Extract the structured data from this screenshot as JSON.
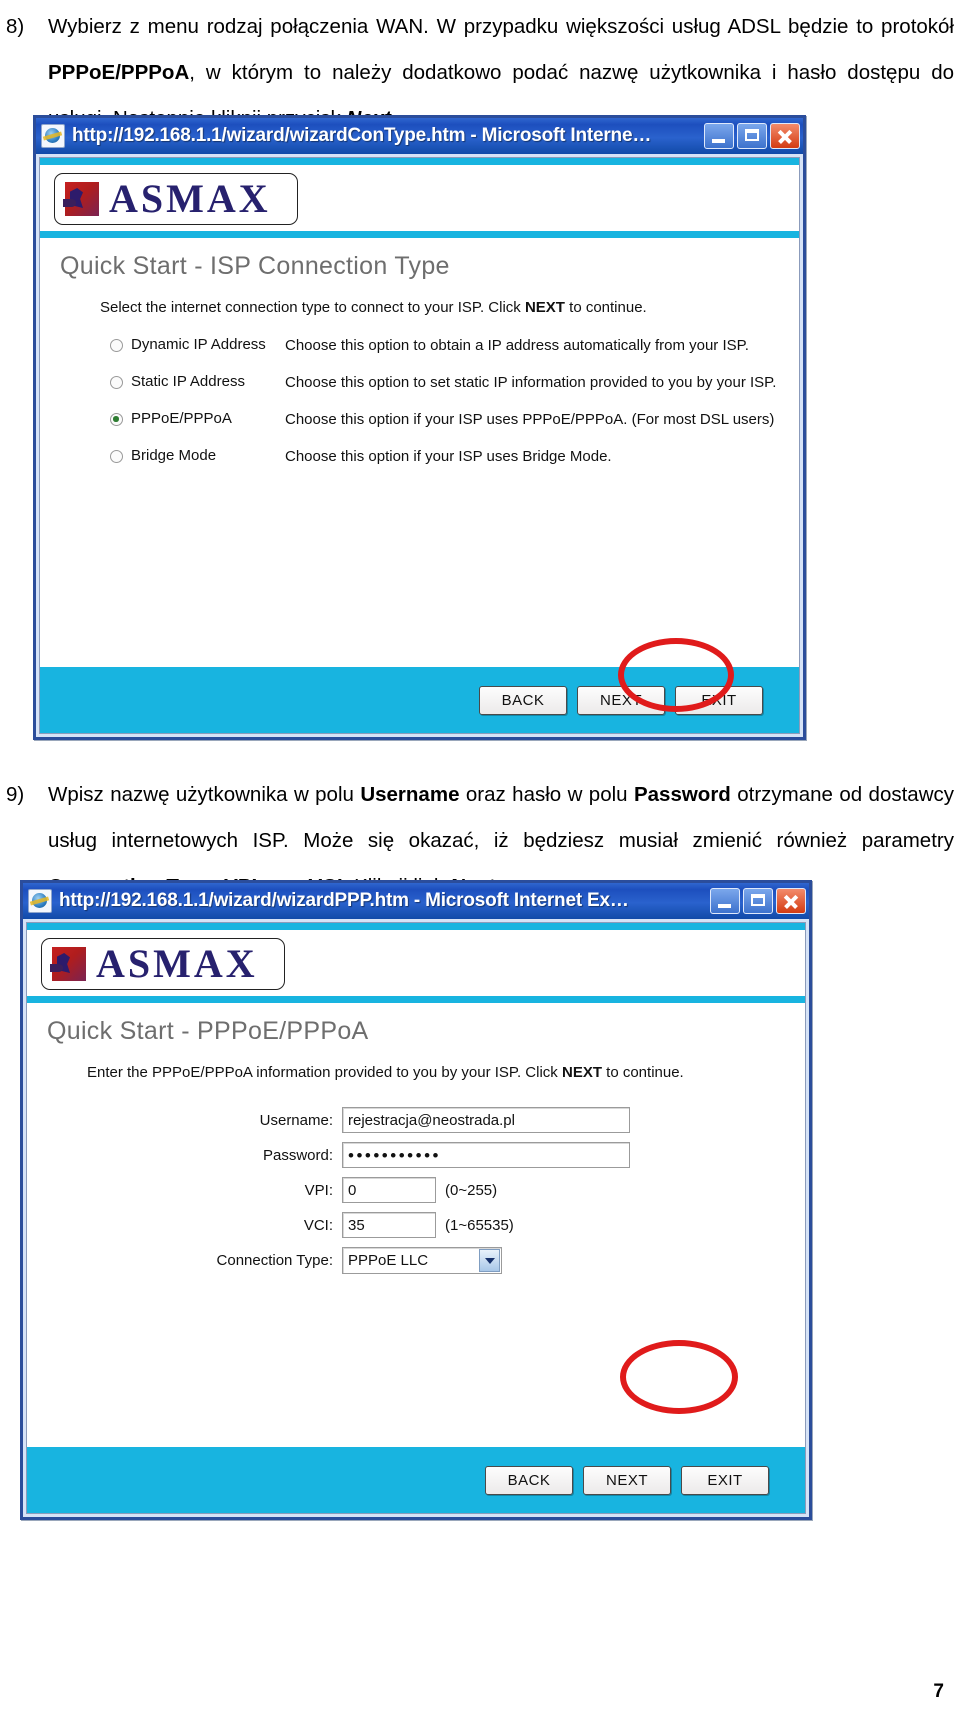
{
  "document": {
    "page_number": "7",
    "steps": [
      {
        "number": "8)",
        "text_parts": [
          {
            "t": "Wybierz z menu rodzaj połączenia WAN. W przypadku większości usług ADSL będzie to protokół ",
            "s": "normal"
          },
          {
            "t": "PPPoE/PPPoA",
            "s": "bold"
          },
          {
            "t": ", w którym to należy dodatkowo podać nazwę użytkownika i hasło dostępu do usługi. Następnie kliknij przycisk ",
            "s": "normal"
          },
          {
            "t": "Next",
            "s": "bolditalic"
          },
          {
            "t": ".",
            "s": "normal"
          }
        ]
      },
      {
        "number": "9)",
        "text_parts": [
          {
            "t": "Wpisz nazwę użytkownika w polu ",
            "s": "normal"
          },
          {
            "t": "Username",
            "s": "bold"
          },
          {
            "t": " oraz hasło w polu ",
            "s": "normal"
          },
          {
            "t": "Password",
            "s": "bold"
          },
          {
            "t": " otrzymane od dostawcy usług internetowych ISP. Może się okazać, iż będziesz musiał zmienić również parametry ",
            "s": "normal"
          },
          {
            "t": "Connection Type",
            "s": "bold"
          },
          {
            "t": ", ",
            "s": "normal"
          },
          {
            "t": "VPI",
            "s": "bold"
          },
          {
            "t": " oraz ",
            "s": "normal"
          },
          {
            "t": "VCI",
            "s": "bold"
          },
          {
            "t": ". Kliknij link ",
            "s": "normal"
          },
          {
            "t": "Next",
            "s": "bolditalic"
          },
          {
            "t": ".",
            "s": "normal"
          }
        ]
      }
    ]
  },
  "colors": {
    "accent_cyan": "#18b4e0",
    "title_blue": "#1d4fbe",
    "logo_navy": "#27216e",
    "logo_red": "#c62020",
    "annotation_red": "#e01b1b",
    "radio_selected_green": "#2e7d32"
  },
  "window1": {
    "title": "http://192.168.1.1/wizard/wizardConType.htm - Microsoft Interne…",
    "titlebar_icon": "internet-explorer-icon",
    "controls": {
      "minimize": "minimize-icon",
      "maximize": "maximize-icon",
      "close": "close-icon"
    },
    "brand": "ASMAX",
    "heading": "Quick Start - ISP Connection Type",
    "description_pre": "Select the internet connection type to connect to your ISP. Click ",
    "description_bold": "NEXT",
    "description_post": " to continue.",
    "options": [
      {
        "label": "Dynamic IP Address",
        "selected": false,
        "description": "Choose this option to obtain a IP address automatically from your ISP."
      },
      {
        "label": "Static IP Address",
        "selected": false,
        "description": "Choose this option to set static IP information provided to you by your ISP."
      },
      {
        "label": "PPPoE/PPPoA",
        "selected": true,
        "description": "Choose this option if your ISP uses PPPoE/PPPoA. (For most DSL users)"
      },
      {
        "label": "Bridge Mode",
        "selected": false,
        "description": "Choose this option if your ISP uses Bridge Mode."
      }
    ],
    "buttons": [
      "BACK",
      "NEXT",
      "EXIT"
    ],
    "annotation": "red-ellipse-around-next-button"
  },
  "window2": {
    "title": "http://192.168.1.1/wizard/wizardPPP.htm - Microsoft Internet Ex…",
    "titlebar_icon": "internet-explorer-icon",
    "controls": {
      "minimize": "minimize-icon",
      "maximize": "maximize-icon",
      "close": "close-icon"
    },
    "brand": "ASMAX",
    "heading": "Quick Start - PPPoE/PPPoA",
    "description_pre": "Enter the PPPoE/PPPoA information provided to you by your ISP. Click ",
    "description_bold": "NEXT",
    "description_post": " to continue.",
    "fields": {
      "username": {
        "label": "Username:",
        "value": "rejestracja@neostrada.pl"
      },
      "password": {
        "label": "Password:",
        "value": "•••••••••••"
      },
      "vpi": {
        "label": "VPI:",
        "value": "0",
        "hint": "(0~255)"
      },
      "vci": {
        "label": "VCI:",
        "value": "35",
        "hint": "(1~65535)"
      },
      "connection_type": {
        "label": "Connection Type:",
        "value": "PPPoE LLC",
        "arrow": "chevron-down-icon"
      }
    },
    "buttons": [
      "BACK",
      "NEXT",
      "EXIT"
    ],
    "annotation": "red-ellipse-around-next-button"
  }
}
